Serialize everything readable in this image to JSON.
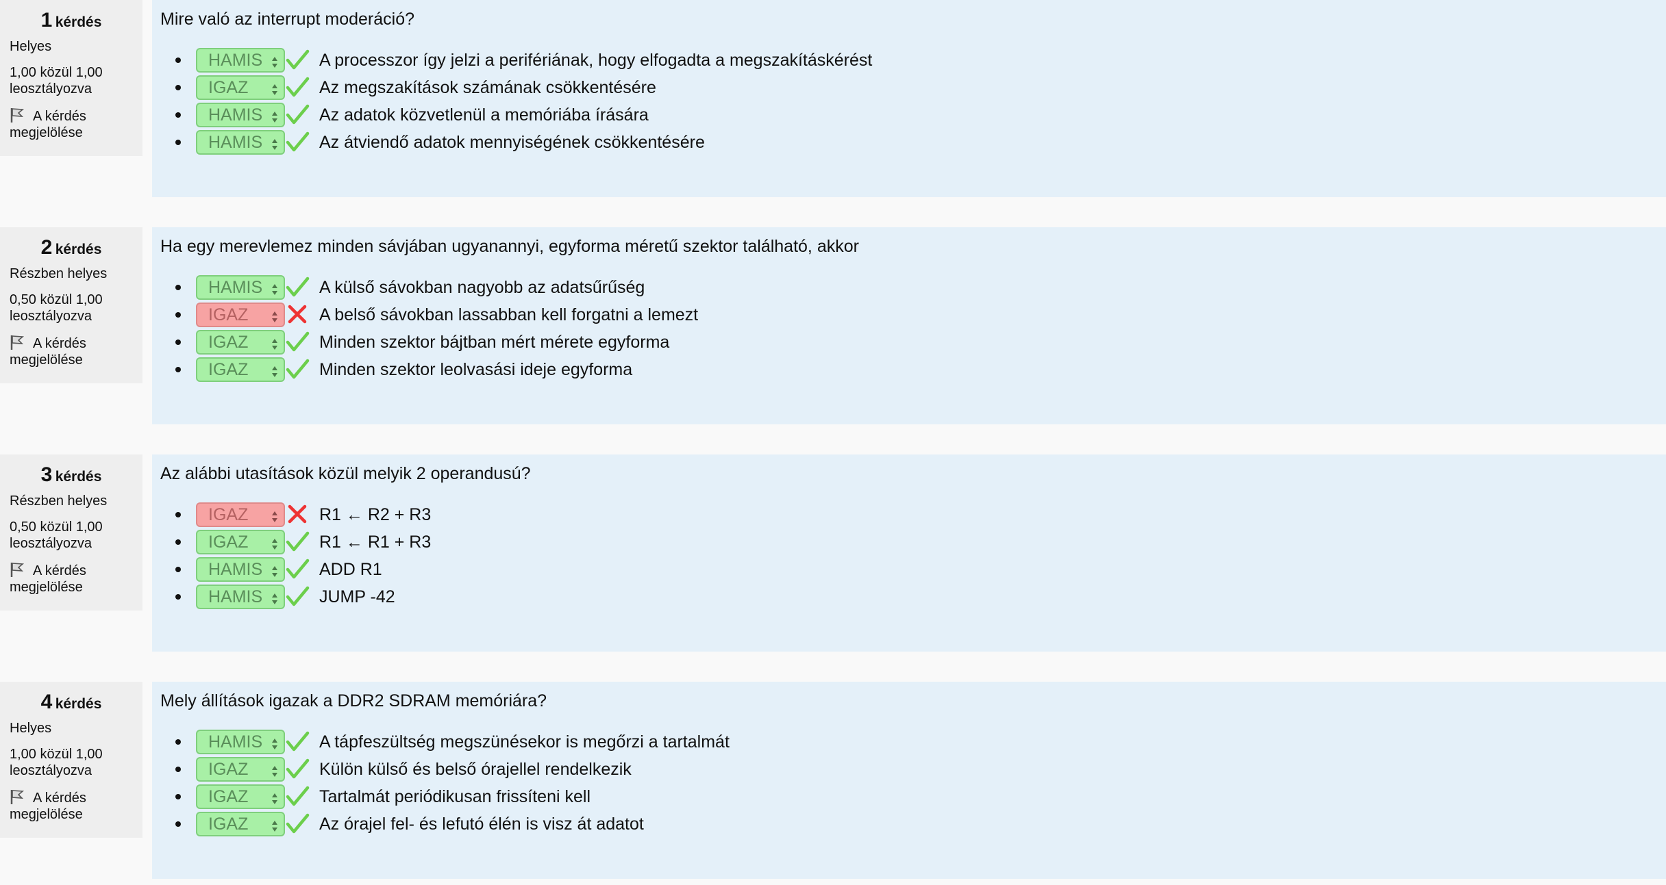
{
  "ui": {
    "question_word": "kérdés",
    "grade_suffix": "leosztályozva",
    "flag_label": "A kérdés megjelölése"
  },
  "colors": {
    "correct_bg": "#a8f0a6",
    "wrong_bg": "#f7a3a3",
    "check": "#6ccf4c",
    "cross": "#ee3333",
    "content_bg": "#e4f0f9",
    "info_bg": "#eeeeee"
  },
  "questions": [
    {
      "number": "1",
      "state": "Helyes",
      "grade": "1,00 közül 1,00",
      "text": "Mire való az interrupt moderáció?",
      "answers": [
        {
          "choice": "HAMIS",
          "status": "correct",
          "icon": "check-icon",
          "text": "A processzor így jelzi a perifériának, hogy elfogadta a megszakításkérést"
        },
        {
          "choice": "IGAZ",
          "status": "correct",
          "icon": "check-icon",
          "text": "Az megszakítások számának csökkentésére"
        },
        {
          "choice": "HAMIS",
          "status": "correct",
          "icon": "check-icon",
          "text": "Az adatok közvetlenül a memóriába írására"
        },
        {
          "choice": "HAMIS",
          "status": "correct",
          "icon": "check-icon",
          "text": "Az átviendő adatok mennyiségének csökkentésére"
        }
      ]
    },
    {
      "number": "2",
      "state": "Részben helyes",
      "grade": "0,50 közül 1,00",
      "text": "Ha egy merevlemez minden sávjában ugyanannyi, egyforma méretű szektor található, akkor",
      "answers": [
        {
          "choice": "HAMIS",
          "status": "correct",
          "icon": "check-icon",
          "text": "A külső sávokban nagyobb az adatsűrűség"
        },
        {
          "choice": "IGAZ",
          "status": "wrong",
          "icon": "cross-icon",
          "text": "A belső sávokban lassabban kell forgatni a lemezt"
        },
        {
          "choice": "IGAZ",
          "status": "correct",
          "icon": "check-icon",
          "text": "Minden szektor bájtban mért mérete egyforma"
        },
        {
          "choice": "IGAZ",
          "status": "correct",
          "icon": "check-icon",
          "text": "Minden szektor leolvasási ideje egyforma"
        }
      ]
    },
    {
      "number": "3",
      "state": "Részben helyes",
      "grade": "0,50 közül 1,00",
      "text": "Az alábbi utasítások közül melyik 2 operandusú?",
      "answers": [
        {
          "choice": "IGAZ",
          "status": "wrong",
          "icon": "cross-icon",
          "text": "R1 ← R2 + R3"
        },
        {
          "choice": "IGAZ",
          "status": "correct",
          "icon": "check-icon",
          "text": "R1 ← R1 + R3"
        },
        {
          "choice": "HAMIS",
          "status": "correct",
          "icon": "check-icon",
          "text": "ADD R1"
        },
        {
          "choice": "HAMIS",
          "status": "correct",
          "icon": "check-icon",
          "text": "JUMP -42"
        }
      ]
    },
    {
      "number": "4",
      "state": "Helyes",
      "grade": "1,00 közül 1,00",
      "text": "Mely állítások igazak a DDR2 SDRAM memóriára?",
      "answers": [
        {
          "choice": "HAMIS",
          "status": "correct",
          "icon": "check-icon",
          "text": "A tápfeszültség megszünésekor is megőrzi a tartalmát"
        },
        {
          "choice": "IGAZ",
          "status": "correct",
          "icon": "check-icon",
          "text": "Külön külső és belső órajellel rendelkezik"
        },
        {
          "choice": "IGAZ",
          "status": "correct",
          "icon": "check-icon",
          "text": "Tartalmát periódikusan frissíteni kell"
        },
        {
          "choice": "IGAZ",
          "status": "correct",
          "icon": "check-icon",
          "text": "Az órajel fel- és lefutó élén is visz át adatot"
        }
      ]
    }
  ]
}
